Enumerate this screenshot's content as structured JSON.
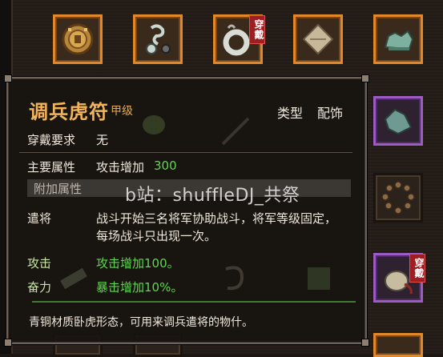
{
  "top_slots": [
    {
      "icon": "tiger-tally-medallion-icon",
      "rarity": "orange",
      "equipped": false
    },
    {
      "icon": "jade-hook-icon",
      "rarity": "orange",
      "equipped": false
    },
    {
      "icon": "jade-ring-icon",
      "rarity": "orange",
      "equipped": true
    },
    {
      "icon": "cloth-scroll-icon",
      "rarity": "orange",
      "equipped": false
    },
    {
      "icon": "jade-beast-figurine-icon",
      "rarity": "orange",
      "equipped": false
    }
  ],
  "right_slots": [
    {
      "icon": "jade-shards-icon",
      "rarity": "purple",
      "equipped": false
    },
    {
      "icon": "prayer-beads-icon",
      "rarity": "none",
      "equipped": false
    },
    {
      "icon": "pouch-icon",
      "rarity": "purple",
      "equipped": true
    }
  ],
  "equipped_label": "穿戴",
  "tooltip": {
    "name": "调兵虎符",
    "grade": "甲级",
    "type_label": "类型",
    "type_value": "配饰",
    "requirement_label": "穿戴要求",
    "requirement_value": "无",
    "main_attr_label": "主要属性",
    "main_attr_text": "攻击增加",
    "main_attr_value": "300",
    "extra_attr_label": "附加属性",
    "general_label": "遣将",
    "general_text_line1": "战斗开始三名将军协助战斗，将军等级固定，",
    "general_text_line2": "每场战斗只出现一次。",
    "attack_label": "攻击",
    "attack_value": "攻击增加100。",
    "fury_label": "奋力",
    "fury_value": "暴击增加10%。",
    "description": "青铜材质卧虎形态，可用来调兵遣将的物什。"
  },
  "watermark": "b站：shuffleDJ_共祭",
  "colors": {
    "orange_frame": "#e0882a",
    "purple_frame": "#9c5cc4",
    "title": "#f2b45a",
    "green_value": "#5ed84e",
    "badge_red": "#a01e22"
  }
}
